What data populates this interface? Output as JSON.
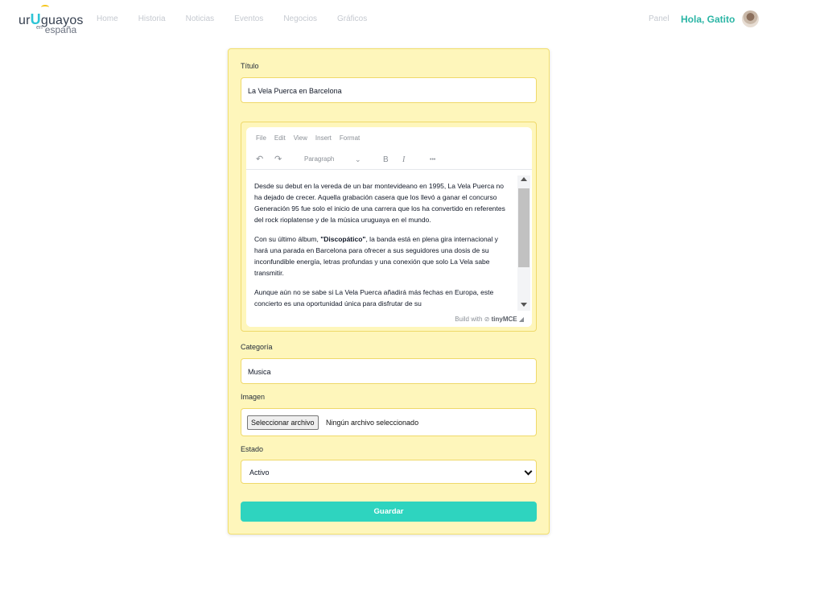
{
  "brand": {
    "logo_main_prefix": "ur",
    "logo_main_letter": "U",
    "logo_main_suffix": "guayos",
    "logo_sub_small": "en",
    "logo_sub": "españa"
  },
  "nav": {
    "items": [
      {
        "label": "Home"
      },
      {
        "label": "Historia"
      },
      {
        "label": "Noticias"
      },
      {
        "label": "Eventos"
      },
      {
        "label": "Negocios"
      },
      {
        "label": "Gráficos"
      }
    ],
    "panel_label": "Panel",
    "greeting": "Hola, Gatito"
  },
  "form": {
    "title_label": "Título",
    "title_value": "La Vela Puerca en Barcelona",
    "editor": {
      "menu": [
        "File",
        "Edit",
        "View",
        "Insert",
        "Format"
      ],
      "block_format": "Paragraph",
      "bold_glyph": "B",
      "italic_glyph": "I",
      "more_glyph": "•••",
      "paragraphs": {
        "p1": "Desde su debut en la vereda de un bar montevideano en 1995, La Vela Puerca no ha dejado de crecer. Aquella grabación casera que los llevó a ganar el concurso Generación 95 fue solo el inicio de una carrera que los ha convertido en referentes del rock rioplatense y de la música uruguaya en el mundo.",
        "p2_before": "Con su último álbum, ",
        "p2_bold": "\"Discopático\"",
        "p2_after": ", la banda está en plena gira internacional y hará una parada en Barcelona para ofrecer a sus seguidores una dosis de su inconfundible energía, letras profundas y una conexión que solo La Vela sabe transmitir.",
        "p3": "Aunque aún no se sabe si La Vela Puerca añadirá más fechas en Europa, este concierto es una oportunidad única para disfrutar de su"
      },
      "build_prefix": "Build with",
      "build_brand": "tinyMCE"
    },
    "category_label": "Categoría",
    "category_value": "Musica",
    "image_label": "Imagen",
    "file_button": "Seleccionar archivo",
    "file_status": "Ningún archivo seleccionado",
    "status_label": "Estado",
    "status_value": "Activo",
    "save_label": "Guardar"
  },
  "colors": {
    "accent": "#2ed4bf",
    "greeting": "#2bb5a5",
    "card_bg": "#fef6bb",
    "card_border": "#f1df6e"
  }
}
